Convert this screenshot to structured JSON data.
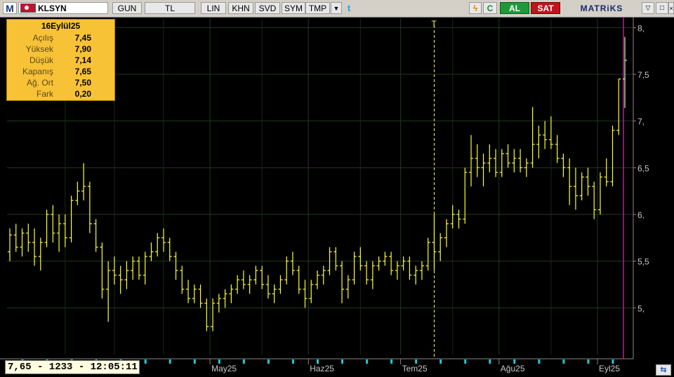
{
  "toolbar": {
    "logo": "M",
    "symbol": "KLSYN",
    "period": "GUN",
    "currency": "TL",
    "buttons": [
      "LIN",
      "KHN",
      "SVD",
      "SYM",
      "TMP"
    ],
    "dropdown": "▼",
    "twitter": "t",
    "bolt": "ϟ",
    "refresh": "C",
    "buy": "AL",
    "sell": "SAT",
    "brand": "MATRiKS",
    "win_min": "▽",
    "win_max": "□",
    "win_close": "×"
  },
  "info_box": {
    "date": "16Eylül25",
    "rows": [
      {
        "label": "Açılış",
        "value": "7,45"
      },
      {
        "label": "Yüksek",
        "value": "7,90"
      },
      {
        "label": "Düşük",
        "value": "7,14"
      },
      {
        "label": "Kapanış",
        "value": "7,65"
      },
      {
        "label": "Ağ. Ort",
        "value": "7,50"
      },
      {
        "label": "Fark",
        "value": "0,20"
      }
    ]
  },
  "status": {
    "text": "7,65 - 1233 - 12:05:11"
  },
  "corner_icon": "⇆",
  "chart_data": {
    "type": "ohlc",
    "ylim": [
      4.5,
      8.1
    ],
    "y_ticks": [
      5.0,
      5.5,
      6.0,
      6.5,
      7.0,
      7.5,
      8.0
    ],
    "y_tick_labels": [
      "5,",
      "5,5",
      "6,",
      "6,5",
      "7,",
      "7,5",
      "8,"
    ],
    "x_ticks": [
      {
        "label": "May25",
        "index": 33
      },
      {
        "label": "Haz25",
        "index": 49
      },
      {
        "label": "Tem25",
        "index": 64
      },
      {
        "label": "Ağu25",
        "index": 80
      },
      {
        "label": "Eyl25",
        "index": 96
      }
    ],
    "vertical_marker": {
      "label": "T",
      "index": 69
    },
    "grid": true,
    "bar_color": "#ffff33",
    "last_bar_color": "#c0ffa0",
    "bars": [
      [
        5.6,
        5.85,
        5.5,
        5.78
      ],
      [
        5.78,
        5.9,
        5.6,
        5.65
      ],
      [
        5.65,
        5.85,
        5.55,
        5.8
      ],
      [
        5.8,
        5.9,
        5.6,
        5.7
      ],
      [
        5.7,
        5.85,
        5.45,
        5.55
      ],
      [
        5.55,
        5.75,
        5.4,
        5.7
      ],
      [
        5.7,
        6.05,
        5.65,
        6.0
      ],
      [
        6.0,
        6.1,
        5.7,
        5.8
      ],
      [
        5.8,
        6.0,
        5.6,
        5.9
      ],
      [
        5.9,
        6.0,
        5.65,
        5.75
      ],
      [
        5.75,
        6.2,
        5.7,
        6.15
      ],
      [
        6.15,
        6.35,
        6.1,
        6.25
      ],
      [
        6.25,
        6.55,
        6.15,
        6.3
      ],
      [
        6.3,
        6.35,
        5.8,
        5.9
      ],
      [
        5.9,
        5.95,
        5.6,
        5.65
      ],
      [
        5.65,
        5.7,
        5.1,
        5.2
      ],
      [
        5.2,
        5.5,
        4.85,
        5.4
      ],
      [
        5.4,
        5.55,
        5.25,
        5.35
      ],
      [
        5.35,
        5.45,
        5.15,
        5.3
      ],
      [
        5.3,
        5.5,
        5.2,
        5.4
      ],
      [
        5.4,
        5.55,
        5.3,
        5.5
      ],
      [
        5.5,
        5.55,
        5.3,
        5.35
      ],
      [
        5.35,
        5.6,
        5.25,
        5.55
      ],
      [
        5.55,
        5.7,
        5.5,
        5.6
      ],
      [
        5.6,
        5.8,
        5.55,
        5.75
      ],
      [
        5.75,
        5.85,
        5.6,
        5.7
      ],
      [
        5.7,
        5.75,
        5.5,
        5.55
      ],
      [
        5.55,
        5.6,
        5.3,
        5.4
      ],
      [
        5.4,
        5.45,
        5.15,
        5.2
      ],
      [
        5.2,
        5.3,
        5.05,
        5.1
      ],
      [
        5.1,
        5.25,
        5.05,
        5.2
      ],
      [
        5.2,
        5.25,
        5.0,
        5.05
      ],
      [
        5.05,
        5.1,
        4.75,
        4.8
      ],
      [
        4.8,
        5.1,
        4.75,
        5.05
      ],
      [
        5.05,
        5.15,
        4.95,
        5.1
      ],
      [
        5.1,
        5.2,
        5.0,
        5.15
      ],
      [
        5.15,
        5.25,
        5.05,
        5.2
      ],
      [
        5.2,
        5.35,
        5.15,
        5.3
      ],
      [
        5.3,
        5.4,
        5.2,
        5.25
      ],
      [
        5.25,
        5.35,
        5.15,
        5.3
      ],
      [
        5.3,
        5.45,
        5.25,
        5.4
      ],
      [
        5.4,
        5.45,
        5.2,
        5.25
      ],
      [
        5.25,
        5.35,
        5.1,
        5.15
      ],
      [
        5.15,
        5.25,
        5.05,
        5.2
      ],
      [
        5.2,
        5.35,
        5.15,
        5.3
      ],
      [
        5.3,
        5.55,
        5.25,
        5.5
      ],
      [
        5.5,
        5.6,
        5.35,
        5.4
      ],
      [
        5.4,
        5.45,
        5.15,
        5.2
      ],
      [
        5.2,
        5.3,
        5.0,
        5.1
      ],
      [
        5.1,
        5.3,
        5.05,
        5.25
      ],
      [
        5.25,
        5.4,
        5.2,
        5.35
      ],
      [
        5.35,
        5.45,
        5.25,
        5.4
      ],
      [
        5.4,
        5.65,
        5.35,
        5.6
      ],
      [
        5.6,
        5.65,
        5.4,
        5.45
      ],
      [
        5.45,
        5.5,
        5.05,
        5.2
      ],
      [
        5.2,
        5.35,
        5.1,
        5.3
      ],
      [
        5.3,
        5.6,
        5.25,
        5.55
      ],
      [
        5.55,
        5.65,
        5.4,
        5.45
      ],
      [
        5.45,
        5.5,
        5.25,
        5.3
      ],
      [
        5.3,
        5.5,
        5.2,
        5.45
      ],
      [
        5.45,
        5.55,
        5.4,
        5.5
      ],
      [
        5.5,
        5.6,
        5.45,
        5.55
      ],
      [
        5.55,
        5.6,
        5.35,
        5.4
      ],
      [
        5.4,
        5.5,
        5.3,
        5.45
      ],
      [
        5.45,
        5.55,
        5.4,
        5.5
      ],
      [
        5.5,
        5.55,
        5.3,
        5.35
      ],
      [
        5.35,
        5.45,
        5.25,
        5.4
      ],
      [
        5.4,
        5.5,
        5.3,
        5.45
      ],
      [
        5.45,
        5.75,
        5.4,
        5.7
      ],
      [
        5.7,
        6.0,
        5.4,
        5.6
      ],
      [
        5.6,
        5.8,
        5.5,
        5.75
      ],
      [
        5.75,
        5.95,
        5.65,
        5.9
      ],
      [
        5.9,
        6.1,
        5.85,
        6.0
      ],
      [
        6.0,
        6.05,
        5.85,
        5.95
      ],
      [
        5.95,
        6.5,
        5.9,
        6.45
      ],
      [
        6.45,
        6.85,
        6.3,
        6.6
      ],
      [
        6.6,
        6.75,
        6.4,
        6.5
      ],
      [
        6.5,
        6.65,
        6.3,
        6.55
      ],
      [
        6.55,
        6.75,
        6.45,
        6.6
      ],
      [
        6.6,
        6.7,
        6.4,
        6.45
      ],
      [
        6.45,
        6.7,
        6.4,
        6.65
      ],
      [
        6.65,
        6.75,
        6.5,
        6.55
      ],
      [
        6.55,
        6.7,
        6.45,
        6.6
      ],
      [
        6.6,
        6.7,
        6.45,
        6.5
      ],
      [
        6.5,
        6.6,
        6.4,
        6.55
      ],
      [
        6.55,
        7.15,
        6.5,
        6.75
      ],
      [
        6.75,
        6.95,
        6.6,
        6.85
      ],
      [
        6.85,
        7.0,
        6.7,
        6.8
      ],
      [
        6.8,
        7.05,
        6.7,
        6.75
      ],
      [
        6.75,
        6.85,
        6.55,
        6.6
      ],
      [
        6.6,
        6.65,
        6.4,
        6.5
      ],
      [
        6.5,
        6.6,
        6.1,
        6.3
      ],
      [
        6.3,
        6.5,
        6.05,
        6.2
      ],
      [
        6.2,
        6.45,
        6.15,
        6.4
      ],
      [
        6.4,
        6.5,
        6.2,
        6.3
      ],
      [
        6.3,
        6.35,
        5.95,
        6.05
      ],
      [
        6.05,
        6.45,
        6.0,
        6.4
      ],
      [
        6.4,
        6.6,
        6.3,
        6.35
      ],
      [
        6.35,
        6.95,
        6.3,
        6.9
      ],
      [
        6.9,
        7.45,
        6.85,
        7.45
      ],
      [
        7.45,
        7.9,
        7.14,
        7.65
      ]
    ]
  }
}
